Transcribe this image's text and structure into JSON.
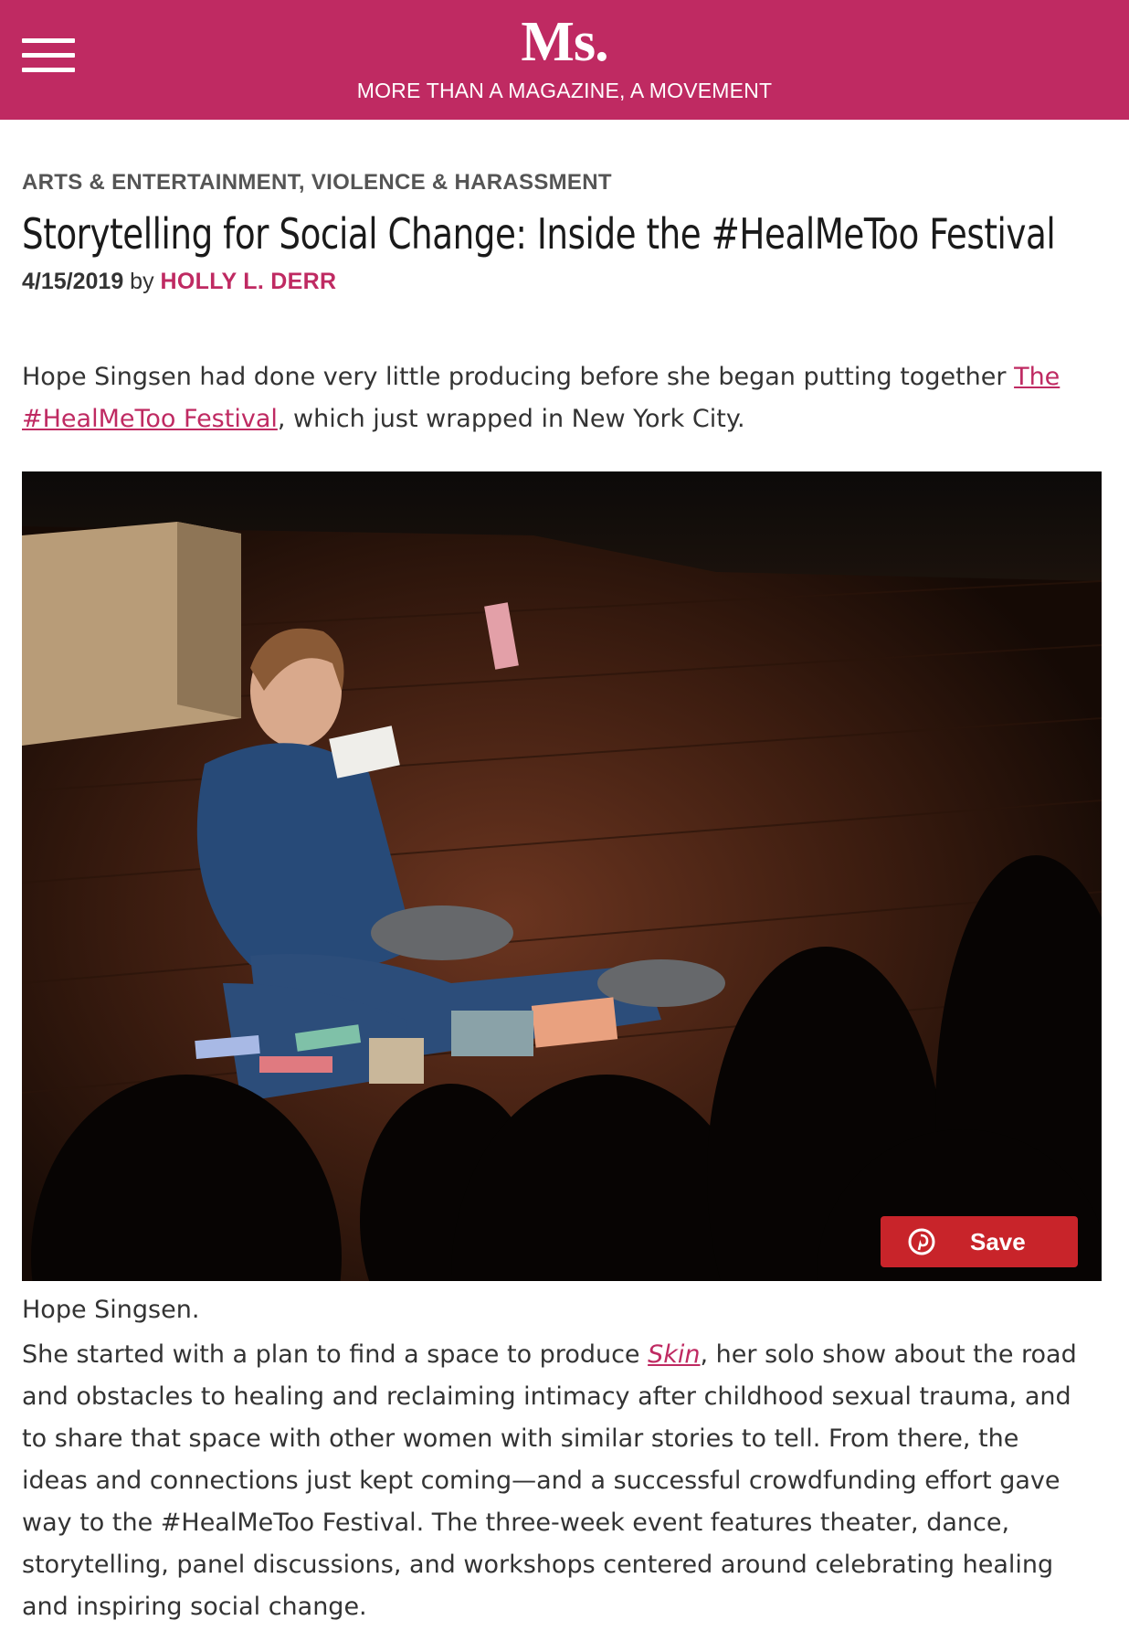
{
  "header": {
    "logo": "Ms.",
    "tagline": "MORE THAN A MAGAZINE, A MOVEMENT",
    "brand_color": "#bf2a62",
    "menu_icon": "hamburger-menu-icon"
  },
  "article": {
    "categories": [
      "ARTS & ENTERTAINMENT",
      "VIOLENCE & HARASSMENT"
    ],
    "category_separator": ",",
    "title": "Storytelling for Social Change: Inside the #HealMeToo Festival",
    "date": "4/15/2019",
    "by": "by",
    "author": "HOLLY L. DERR",
    "lead_before": "Hope Singsen had done very little producing before she began putting together ",
    "lead_link": "The #HealMeToo Festival",
    "lead_after": ", which just wrapped in New York City.",
    "image_caption": "Hope Singsen.",
    "save_button": "Save",
    "save_icon": "pinterest-icon",
    "body_before": "She started with a plan to find a space to produce ",
    "body_link": "Skin",
    "body_after": ", her solo show about the road and obstacles to healing and reclaiming intimacy after childhood sexual trauma, and to share that space with other women with similar stories to tell. From there, the ideas and connections just kept coming—and a successful crowdfunding effort gave way to the #HealMeToo Festival. The three-week event features theater, dance, storytelling, panel discussions, and workshops centered around celebrating healing and inspiring social change."
  }
}
